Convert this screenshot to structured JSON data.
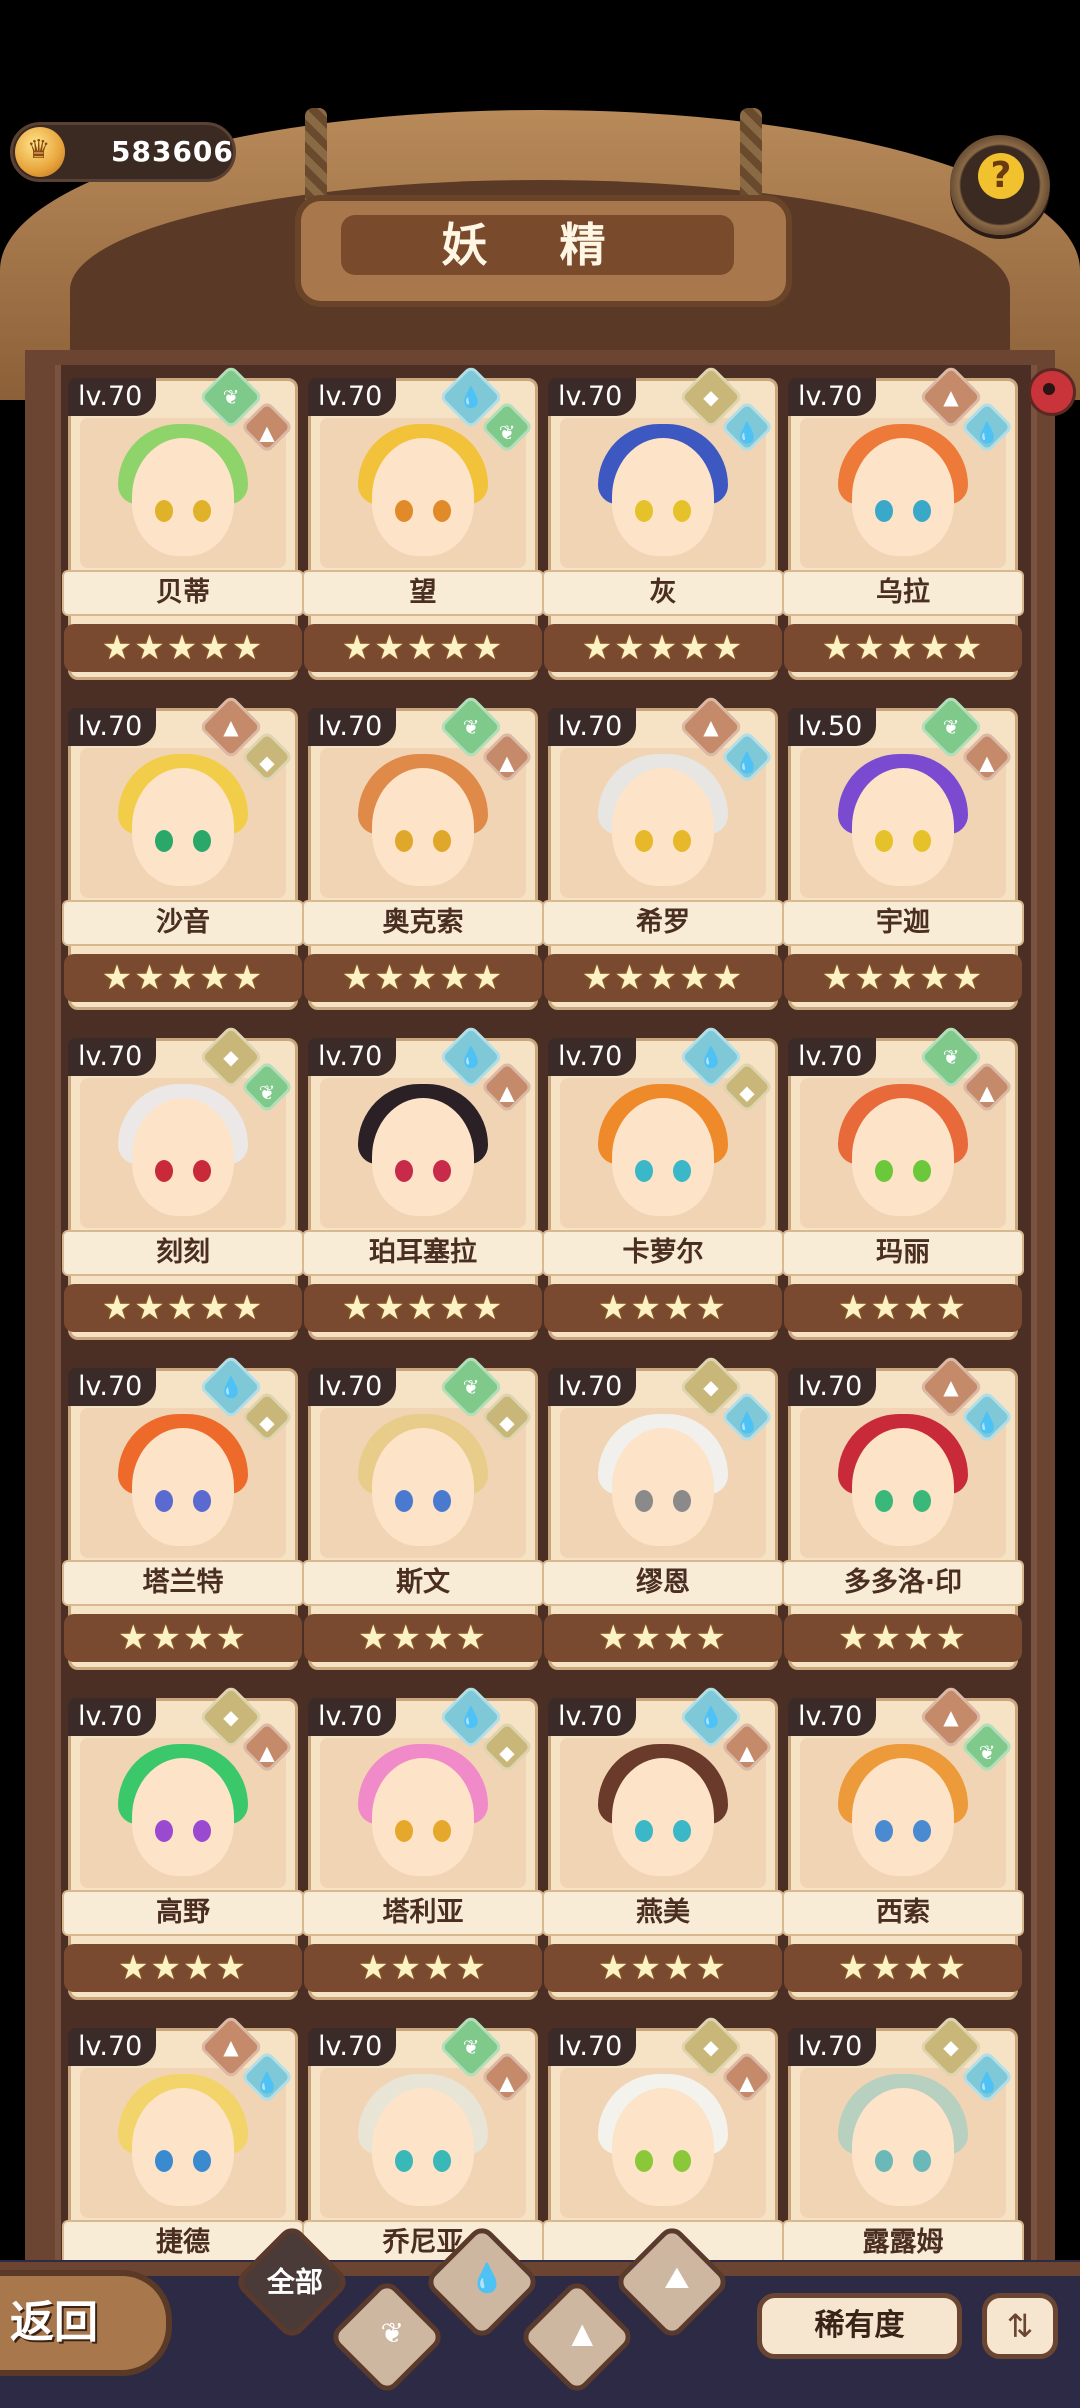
{
  "currency": {
    "value": "583606"
  },
  "title": "妖 精",
  "back_label": "返回",
  "filters": {
    "all_label": "全部",
    "rarity_label": "稀有度",
    "sort_icon": "sort-list-icon"
  },
  "colors": {
    "grass": "#7fc98a",
    "water": "#7ec8d8",
    "rock": "#c9b77a",
    "earth": "#c48a6a"
  },
  "fairies": [
    {
      "lv": "lv.70",
      "name": "贝蒂",
      "stars": "★★★★★",
      "elements": [
        "grass",
        "earth"
      ],
      "hair": "#8fd36b",
      "eye": "#e0b22a"
    },
    {
      "lv": "lv.70",
      "name": "望",
      "stars": "★★★★★",
      "elements": [
        "water",
        "grass"
      ],
      "hair": "#f2c23a",
      "eye": "#e08a2a"
    },
    {
      "lv": "lv.70",
      "name": "灰",
      "stars": "★★★★★",
      "elements": [
        "rock",
        "water"
      ],
      "hair": "#3d58c0",
      "eye": "#e6c22a"
    },
    {
      "lv": "lv.70",
      "name": "乌拉",
      "stars": "★★★★★",
      "elements": [
        "earth",
        "water"
      ],
      "hair": "#ee7a3a",
      "eye": "#3aa8c8"
    },
    {
      "lv": "lv.70",
      "name": "沙音",
      "stars": "★★★★★",
      "elements": [
        "earth",
        "rock"
      ],
      "hair": "#f2cd4a",
      "eye": "#2aa86a"
    },
    {
      "lv": "lv.70",
      "name": "奥克索",
      "stars": "★★★★★",
      "elements": [
        "grass",
        "earth"
      ],
      "hair": "#e08a4a",
      "eye": "#e0a82a"
    },
    {
      "lv": "lv.70",
      "name": "希罗",
      "stars": "★★★★★",
      "elements": [
        "earth",
        "water"
      ],
      "hair": "#e8e6e2",
      "eye": "#e6b82a"
    },
    {
      "lv": "lv.50",
      "name": "宇迦",
      "stars": "★★★★★",
      "elements": [
        "grass",
        "earth"
      ],
      "hair": "#7a4ad0",
      "eye": "#e6c22a"
    },
    {
      "lv": "lv.70",
      "name": "刻刻",
      "stars": "★★★★★",
      "elements": [
        "rock",
        "grass"
      ],
      "hair": "#ece8e8",
      "eye": "#c82a3a"
    },
    {
      "lv": "lv.70",
      "name": "珀耳塞拉",
      "stars": "★★★★★",
      "elements": [
        "water",
        "earth"
      ],
      "hair": "#2a2026",
      "eye": "#c82a4a"
    },
    {
      "lv": "lv.70",
      "name": "卡萝尔",
      "stars": "★★★★",
      "elements": [
        "water",
        "rock"
      ],
      "hair": "#ee8a2a",
      "eye": "#3ab8c8"
    },
    {
      "lv": "lv.70",
      "name": "玛丽",
      "stars": "★★★★",
      "elements": [
        "grass",
        "earth"
      ],
      "hair": "#e86a3a",
      "eye": "#6ac83a"
    },
    {
      "lv": "lv.70",
      "name": "塔兰特",
      "stars": "★★★★",
      "elements": [
        "water",
        "rock"
      ],
      "hair": "#ee6a2a",
      "eye": "#5a6ad0"
    },
    {
      "lv": "lv.70",
      "name": "斯文",
      "stars": "★★★★",
      "elements": [
        "grass",
        "rock"
      ],
      "hair": "#e8cd8a",
      "eye": "#4a7ad0"
    },
    {
      "lv": "lv.70",
      "name": "缪恩",
      "stars": "★★★★",
      "elements": [
        "rock",
        "water"
      ],
      "hair": "#f2f0ec",
      "eye": "#8a8a8a"
    },
    {
      "lv": "lv.70",
      "name": "多多洛·印",
      "stars": "★★★★",
      "elements": [
        "earth",
        "water"
      ],
      "hair": "#c82a3a",
      "eye": "#3ab87a"
    },
    {
      "lv": "lv.70",
      "name": "高野",
      "stars": "★★★★",
      "elements": [
        "rock",
        "earth"
      ],
      "hair": "#3ac86a",
      "eye": "#9a4ad0"
    },
    {
      "lv": "lv.70",
      "name": "塔利亚",
      "stars": "★★★★",
      "elements": [
        "water",
        "rock"
      ],
      "hair": "#f08ac8",
      "eye": "#e6a82a"
    },
    {
      "lv": "lv.70",
      "name": "燕美",
      "stars": "★★★★",
      "elements": [
        "water",
        "earth"
      ],
      "hair": "#6a3a2a",
      "eye": "#3ab8c8"
    },
    {
      "lv": "lv.70",
      "name": "西索",
      "stars": "★★★★",
      "elements": [
        "earth",
        "grass"
      ],
      "hair": "#ec9a3a",
      "eye": "#4a8ad0"
    },
    {
      "lv": "lv.70",
      "name": "捷德",
      "stars": "",
      "elements": [
        "earth",
        "water"
      ],
      "hair": "#f2d46a",
      "eye": "#3a8ad0"
    },
    {
      "lv": "lv.70",
      "name": "乔尼亚",
      "stars": "",
      "elements": [
        "grass",
        "earth"
      ],
      "hair": "#e8e4d6",
      "eye": "#3ab8b8"
    },
    {
      "lv": "lv.70",
      "name": "",
      "stars": "",
      "elements": [
        "rock",
        "earth"
      ],
      "hair": "#f4f2ec",
      "eye": "#8ac83a"
    },
    {
      "lv": "lv.70",
      "name": "露露姆",
      "stars": "",
      "elements": [
        "rock",
        "water"
      ],
      "hair": "#b8d0c0",
      "eye": "#6ab8b8"
    }
  ]
}
